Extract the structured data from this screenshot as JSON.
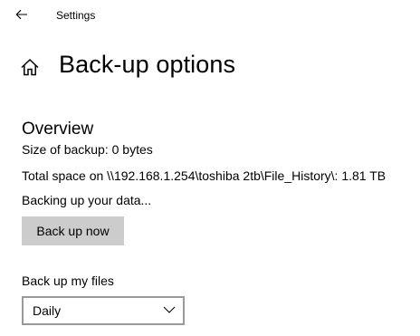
{
  "app": {
    "title": "Settings",
    "back_icon": "arrow-left-icon"
  },
  "header": {
    "icon": "home-icon",
    "title": "Back-up options"
  },
  "overview": {
    "heading": "Overview",
    "size_text": "Size of backup: 0 bytes",
    "total_space_text": "Total space on \\\\192.168.1.254\\toshiba 2tb\\File_History\\: 1.81 TB",
    "status_text": "Backing up your data...",
    "backup_button_label": "Back up now"
  },
  "schedule": {
    "label": "Back up my files",
    "selected": "Daily",
    "chevron_icon": "chevron-down-icon"
  },
  "colors": {
    "button_bg": "#cccccc",
    "dropdown_border": "#999999",
    "background": "#ffffff",
    "text": "#000000"
  }
}
